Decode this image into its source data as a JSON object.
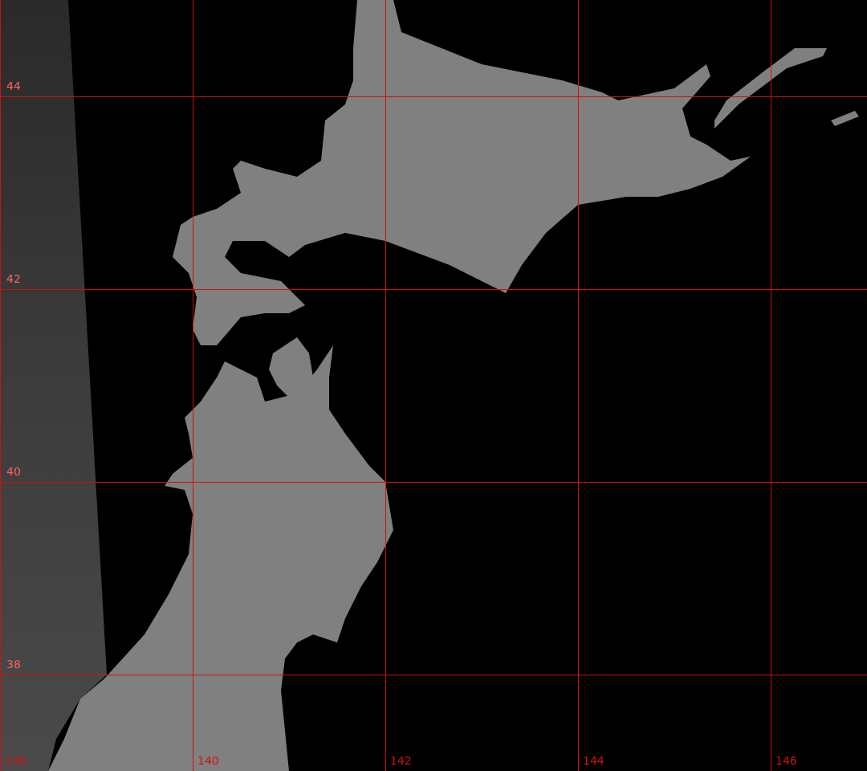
{
  "map": {
    "latitude_labels": [
      "44",
      "42",
      "40",
      "38"
    ],
    "longitude_labels": [
      "138",
      "140",
      "142",
      "144",
      "146"
    ]
  }
}
